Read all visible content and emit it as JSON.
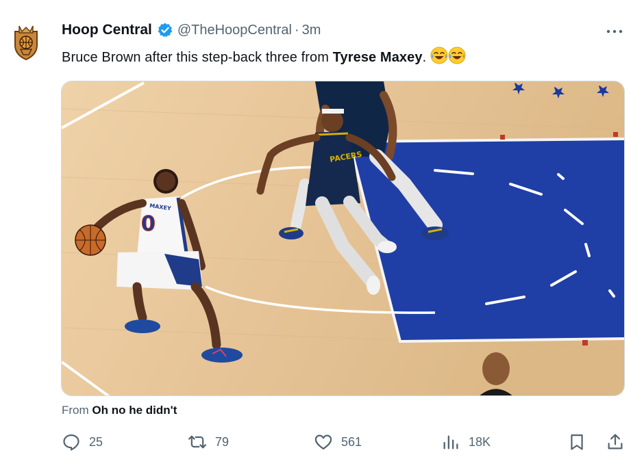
{
  "tweet": {
    "author_name": "Hoop Central",
    "handle": "@TheHoopCentral",
    "separator": "·",
    "time": "3m",
    "text_prefix": "Bruce Brown after this step-back three from ",
    "text_bold": "Tyrese Maxey",
    "text_suffix": ".",
    "emojis": [
      "😂",
      "😂"
    ],
    "source_prefix": "From ",
    "source_name": "Oh no he didn't"
  },
  "media": {
    "jersey_number": "0",
    "jersey_name": "MAXEY",
    "opponent_name": "PACERS"
  },
  "actions": {
    "replies": "25",
    "retweets": "79",
    "likes": "561",
    "views": "18K"
  },
  "colors": {
    "verified": "#1d9bf0",
    "muted_text": "#536471",
    "paint_blue": "#1f3fa6",
    "court_wood": "#e8c99e"
  }
}
